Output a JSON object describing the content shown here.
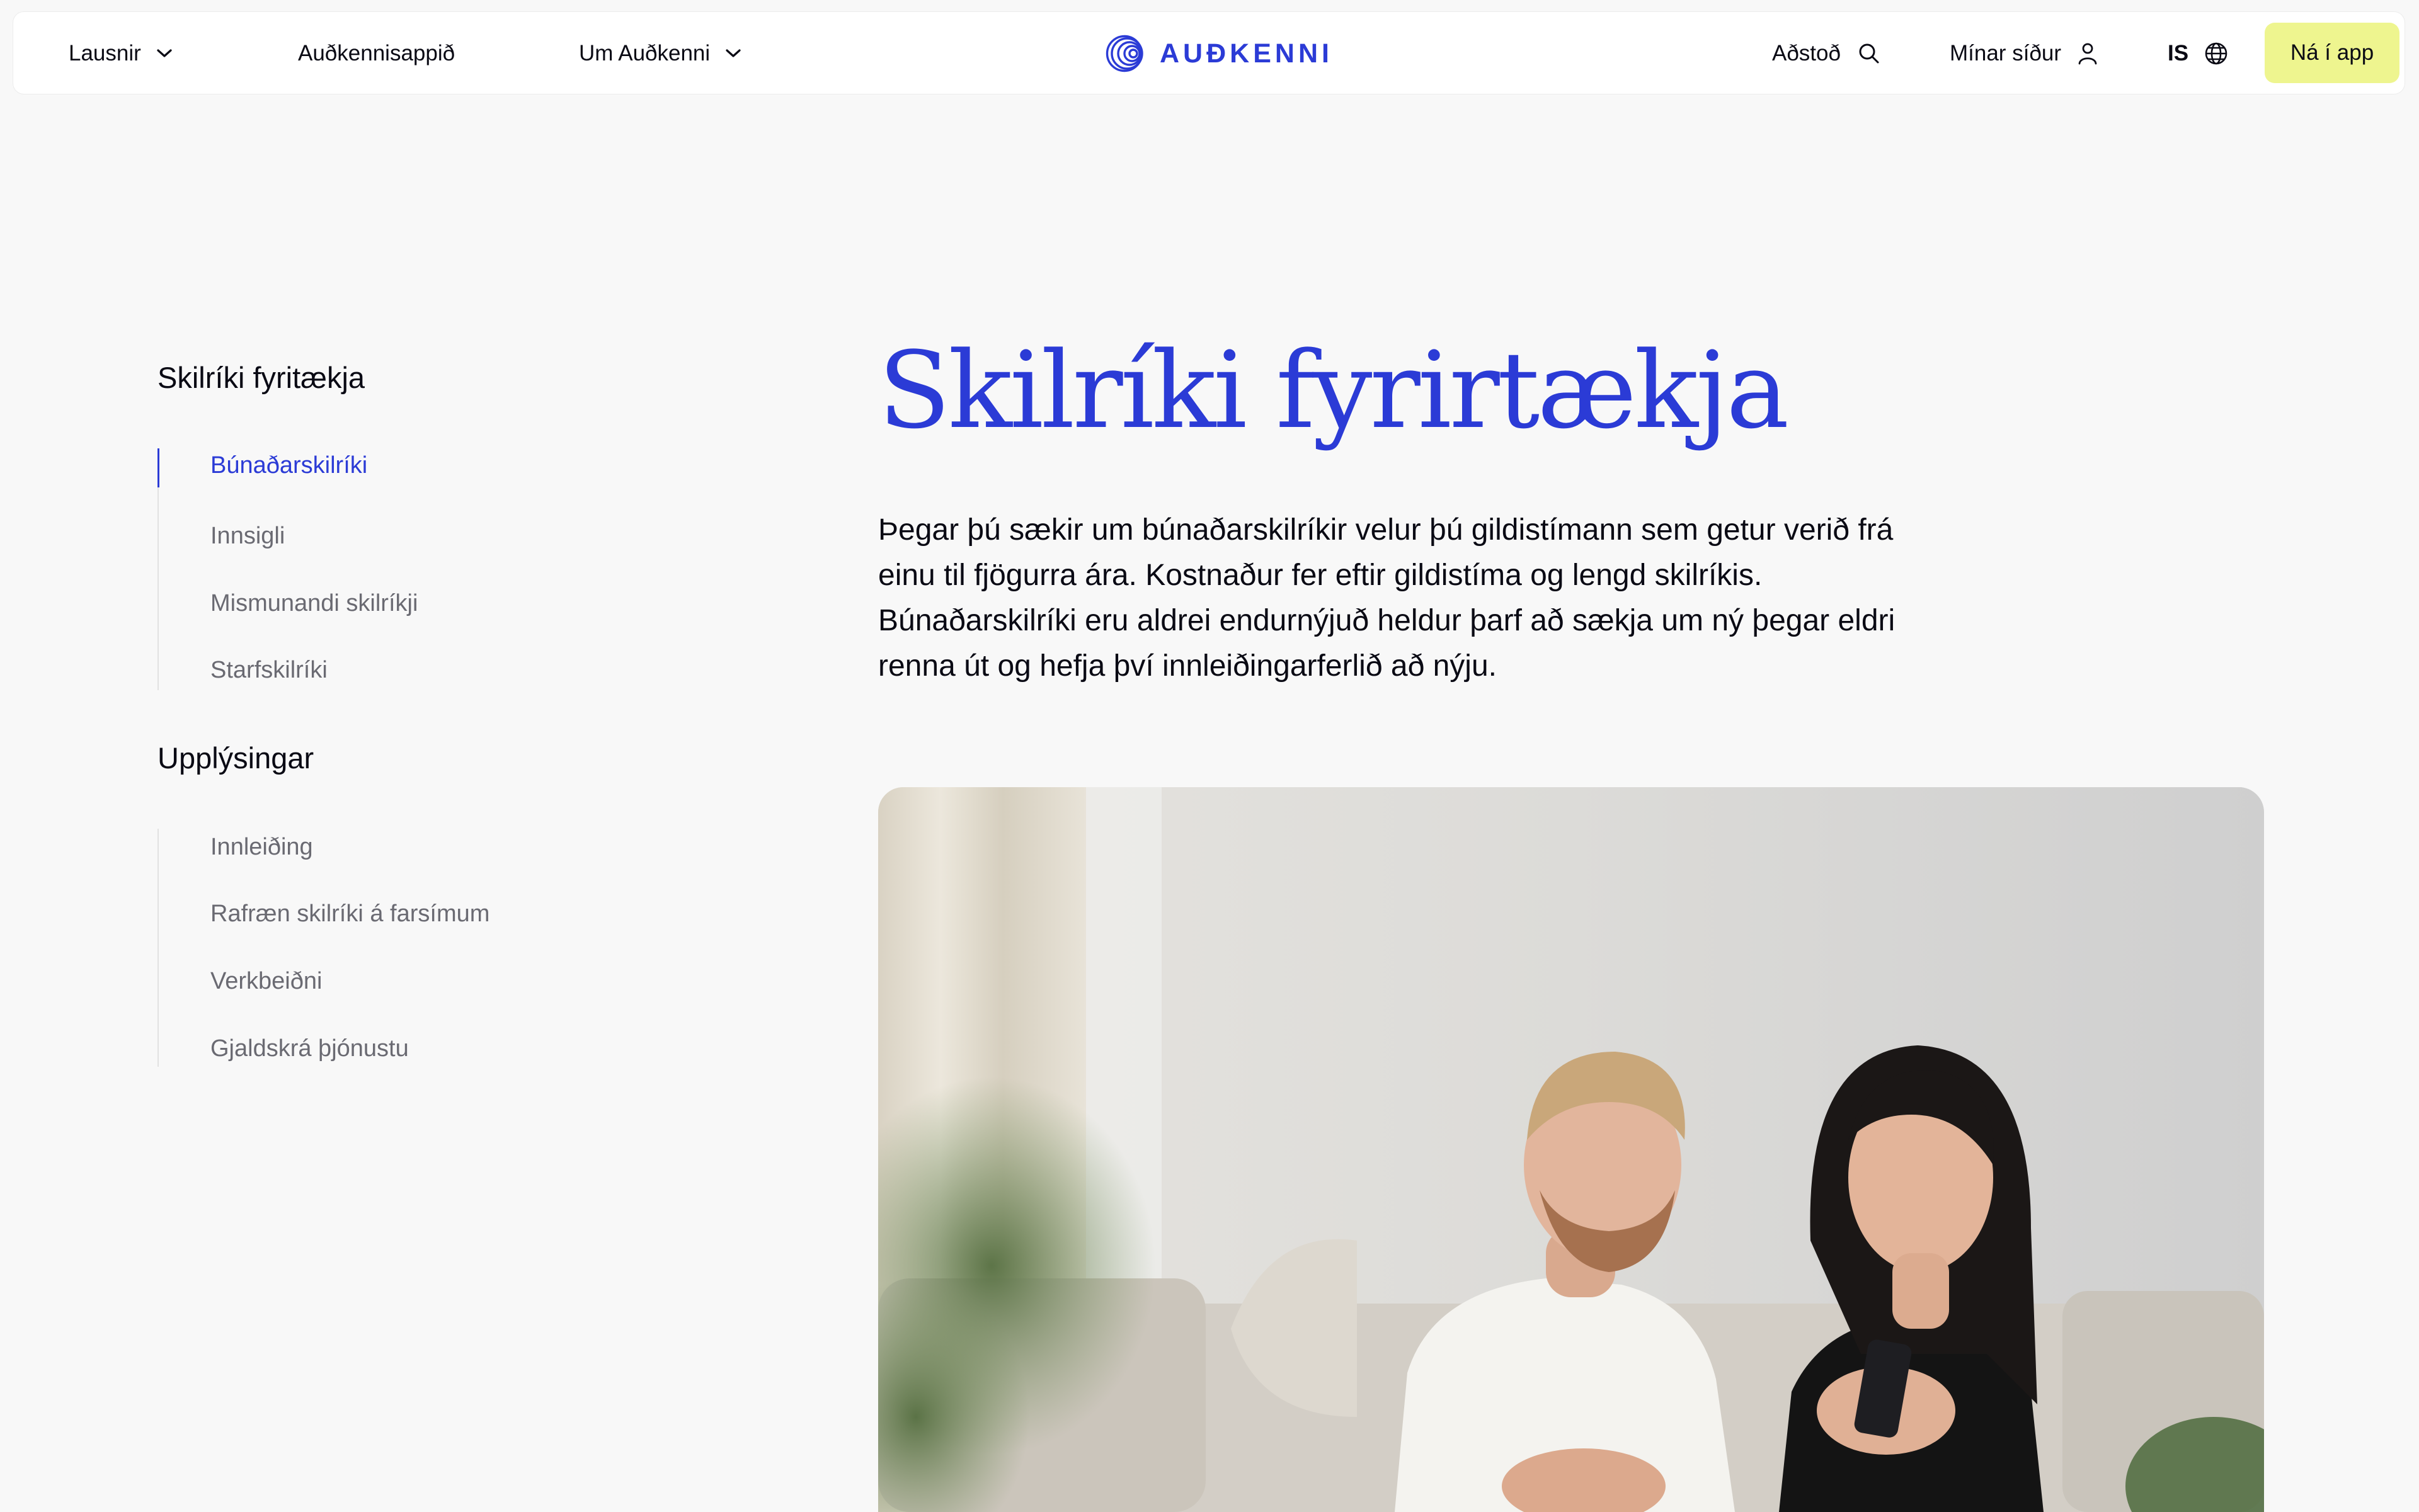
{
  "header": {
    "nav_left": [
      {
        "label": "Lausnir",
        "has_dropdown": true
      },
      {
        "label": "Auðkennisappið",
        "has_dropdown": false
      },
      {
        "label": "Um Auðkenni",
        "has_dropdown": true
      }
    ],
    "logo_text": "AUÐKENNI",
    "nav_right": {
      "help_label": "Aðstoð",
      "account_label": "Mínar síður",
      "language_label": "IS"
    },
    "cta_label": "Ná í app"
  },
  "sidebar": {
    "sections": [
      {
        "title": "Skilríki fyritækja",
        "items": [
          {
            "label": "Búnaðarskilríki",
            "active": true
          },
          {
            "label": "Innsigli",
            "active": false
          },
          {
            "label": "Mismunandi skilríkji",
            "active": false
          },
          {
            "label": "Starfskilríki",
            "active": false
          }
        ]
      },
      {
        "title": "Upplýsingar",
        "items": [
          {
            "label": "Innleiðing",
            "active": false
          },
          {
            "label": "Rafræn skilríki á farsímum",
            "active": false
          },
          {
            "label": "Verkbeiðni",
            "active": false
          },
          {
            "label": "Gjaldskrá þjónustu",
            "active": false
          }
        ]
      }
    ]
  },
  "main": {
    "title": "Skilríki fyrirtækja",
    "intro": "Þegar þú sækir um búnaðarskilríkir velur þú gildistímann sem getur verið frá einu til fjögurra ára. Kostnaður fer eftir gildistíma og lengd skilríkis.  Búnaðarskilríki eru aldrei endurnýjuð heldur þarf að sækja um ný þegar eldri renna út og hefja því innleiðingarferlið að nýju."
  },
  "colors": {
    "brand_blue": "#2b3bd6",
    "cta_yellow": "#eef58f",
    "page_background": "#f8f8f8"
  },
  "icons": {
    "dropdown": "chevron-down-icon",
    "help": "search-icon",
    "account": "user-icon",
    "language": "globe-icon",
    "logo": "fingerprint-rings-icon"
  }
}
